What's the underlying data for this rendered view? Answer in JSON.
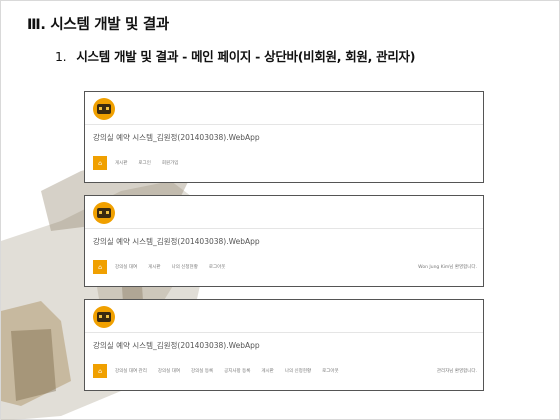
{
  "slide": {
    "heading": "Ⅲ. 시스템 개발 및 결과",
    "subheading_number": "1.",
    "subheading": "시스템 개발 및 결과  - 메인 페이지 - 상단바(비회원, 회원, 관리자)"
  },
  "panels": [
    {
      "app_title": "강의실 예약 시스템_김원정(201403038).WebApp",
      "home_icon": "home-icon",
      "nav": [
        "게시판",
        "로그인",
        "회원가입"
      ],
      "right_text": ""
    },
    {
      "app_title": "강의실 예약 시스템_김원정(201403038).WebApp",
      "home_icon": "home-icon",
      "nav": [
        "강의실 대여",
        "게시판",
        "나의 신청현황",
        "로그아웃"
      ],
      "right_text": "Won Jung Kim님 환영합니다."
    },
    {
      "app_title": "강의실 예약 시스템_김원정(201403038).WebApp",
      "home_icon": "home-icon",
      "nav": [
        "강의실 대여 관리",
        "강의실 대여",
        "강의실 등록",
        "공지사항 등록",
        "게시판",
        "나의 신청현황",
        "로그아웃"
      ],
      "right_text": "관리자님 환영합니다."
    }
  ],
  "colors": {
    "accent": "#f0a000",
    "border": "#555555",
    "nav_text": "#777777"
  }
}
